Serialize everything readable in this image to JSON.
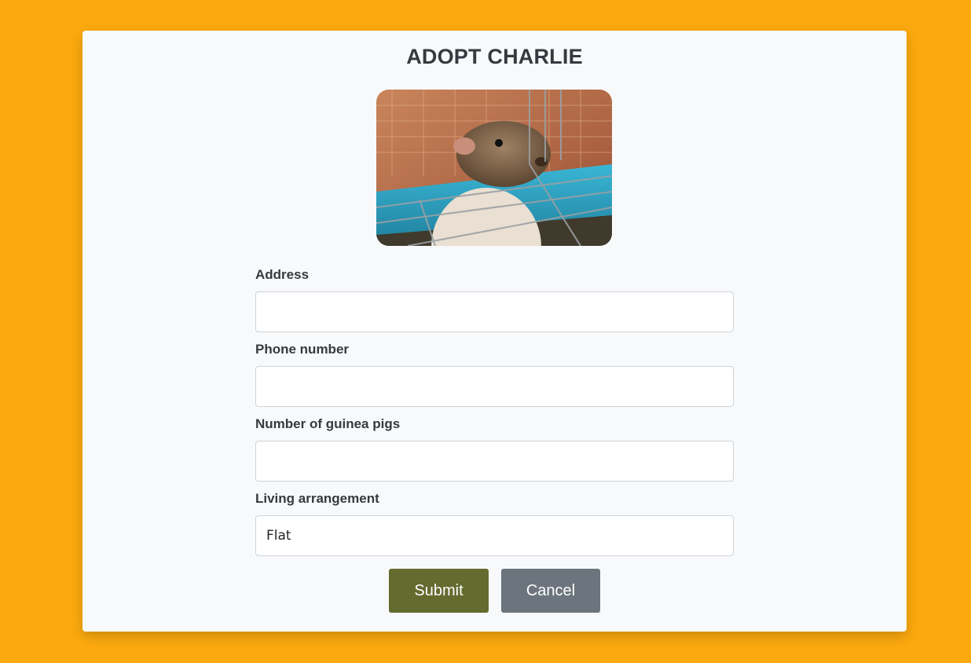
{
  "page": {
    "title": "ADOPT CHARLIE"
  },
  "photo": {
    "subject": "guinea-pig-photo"
  },
  "form": {
    "fields": [
      {
        "label": "Address",
        "value": "",
        "placeholder": ""
      },
      {
        "label": "Phone number",
        "value": "",
        "placeholder": ""
      },
      {
        "label": "Number of guinea pigs",
        "value": "",
        "placeholder": ""
      },
      {
        "label": "Living arrangement",
        "value": "Flat",
        "placeholder": ""
      }
    ]
  },
  "actions": {
    "submit_label": "Submit",
    "cancel_label": "Cancel"
  },
  "colors": {
    "background": "#fba90e",
    "card": "#f8f9fa",
    "submit": "#646b2f",
    "cancel": "#6c757d",
    "text": "#343a40"
  }
}
